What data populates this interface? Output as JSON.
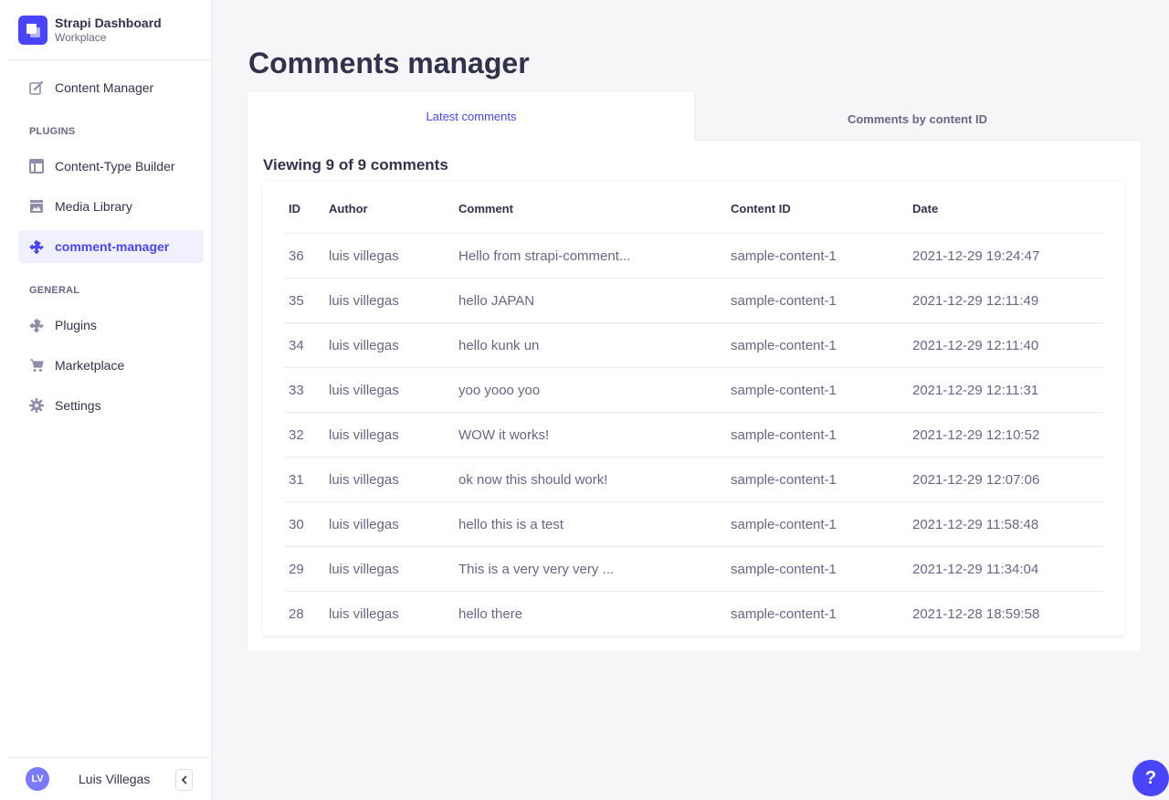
{
  "brand": {
    "title": "Strapi Dashboard",
    "subtitle": "Workplace"
  },
  "nav": {
    "content_manager": "Content Manager",
    "plugins_section": "PLUGINS",
    "content_type_builder": "Content-Type Builder",
    "media_library": "Media Library",
    "comment_manager": "comment-manager",
    "general_section": "GENERAL",
    "plugins": "Plugins",
    "marketplace": "Marketplace",
    "settings": "Settings"
  },
  "user": {
    "initials": "LV",
    "name": "Luis Villegas"
  },
  "page": {
    "title": "Comments manager"
  },
  "tabs": {
    "latest": "Latest comments",
    "by_content_id": "Comments by content ID"
  },
  "viewing": "Viewing 9 of 9 comments",
  "table": {
    "headers": {
      "id": "ID",
      "author": "Author",
      "comment": "Comment",
      "content_id": "Content ID",
      "date": "Date"
    },
    "rows": [
      {
        "id": "36",
        "author": "luis villegas",
        "comment": "Hello from strapi-comment...",
        "content_id": "sample-content-1",
        "date": "2021-12-29 19:24:47"
      },
      {
        "id": "35",
        "author": "luis villegas",
        "comment": "hello JAPAN",
        "content_id": "sample-content-1",
        "date": "2021-12-29 12:11:49"
      },
      {
        "id": "34",
        "author": "luis villegas",
        "comment": "hello kunk un",
        "content_id": "sample-content-1",
        "date": "2021-12-29 12:11:40"
      },
      {
        "id": "33",
        "author": "luis villegas",
        "comment": "yoo yooo yoo",
        "content_id": "sample-content-1",
        "date": "2021-12-29 12:11:31"
      },
      {
        "id": "32",
        "author": "luis villegas",
        "comment": "WOW it works!",
        "content_id": "sample-content-1",
        "date": "2021-12-29 12:10:52"
      },
      {
        "id": "31",
        "author": "luis villegas",
        "comment": "ok now this should work!",
        "content_id": "sample-content-1",
        "date": "2021-12-29 12:07:06"
      },
      {
        "id": "30",
        "author": "luis villegas",
        "comment": "hello this is a test",
        "content_id": "sample-content-1",
        "date": "2021-12-29 11:58:48"
      },
      {
        "id": "29",
        "author": "luis villegas",
        "comment": "This is a very very very ...",
        "content_id": "sample-content-1",
        "date": "2021-12-29 11:34:04"
      },
      {
        "id": "28",
        "author": "luis villegas",
        "comment": "hello there",
        "content_id": "sample-content-1",
        "date": "2021-12-28 18:59:58"
      }
    ]
  },
  "help": "?",
  "colors": {
    "accent": "#4945ff",
    "text": "#32324d",
    "muted": "#666687",
    "background": "#f6f6f9"
  }
}
